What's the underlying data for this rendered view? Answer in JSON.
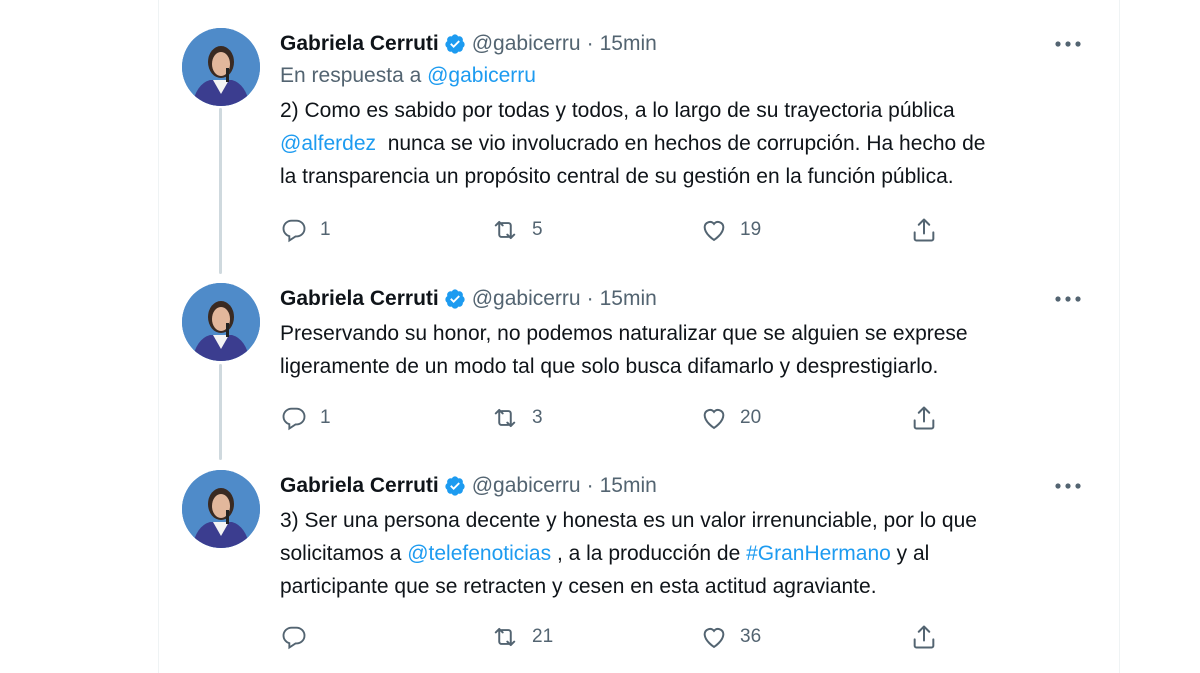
{
  "tweets": [
    {
      "name": "Gabriela Cerruti",
      "handle": "@gabicerru",
      "dot": "·",
      "time": "15min",
      "reply_prefix": "En respuesta a",
      "reply_handle": "@gabicerru",
      "text_parts": {
        "p1": "2) Como es sabido por todas y todos, a lo largo de su trayectoria pública\n",
        "mention": "@alferdez",
        "p2": "  nunca se vio involucrado en hechos de corrupción. Ha hecho de\nla transparencia un propósito central de su gestión en la función pública."
      },
      "replies": "1",
      "retweets": "5",
      "likes": "19"
    },
    {
      "name": "Gabriela Cerruti",
      "handle": "@gabicerru",
      "dot": "·",
      "time": "15min",
      "text": "Preservando su honor, no podemos naturalizar que se alguien se exprese\nligeramente de un modo tal que solo busca difamarlo y desprestigiarlo.",
      "replies": "1",
      "retweets": "3",
      "likes": "20"
    },
    {
      "name": "Gabriela Cerruti",
      "handle": "@gabicerru",
      "dot": "·",
      "time": "15min",
      "text_parts": {
        "p1": "3) Ser una persona decente y honesta es un valor irrenunciable, por lo que\nsolicitamos a ",
        "mention": "@telefenoticias",
        "p2": " , a la producción de ",
        "hashtag": "#GranHermano",
        "p3": " y al\nparticipante que se retracten y cesen en esta actitud agraviante."
      },
      "replies": "",
      "retweets": "21",
      "likes": "36"
    }
  ],
  "icons": {
    "verified": "verified-badge-icon",
    "more": "more-options-icon",
    "reply": "reply-icon",
    "retweet": "retweet-icon",
    "like": "heart-icon",
    "share": "share-icon"
  },
  "colors": {
    "accent": "#1d9bf0",
    "secondary_text": "#536471",
    "thread_line": "#cfd9de"
  }
}
